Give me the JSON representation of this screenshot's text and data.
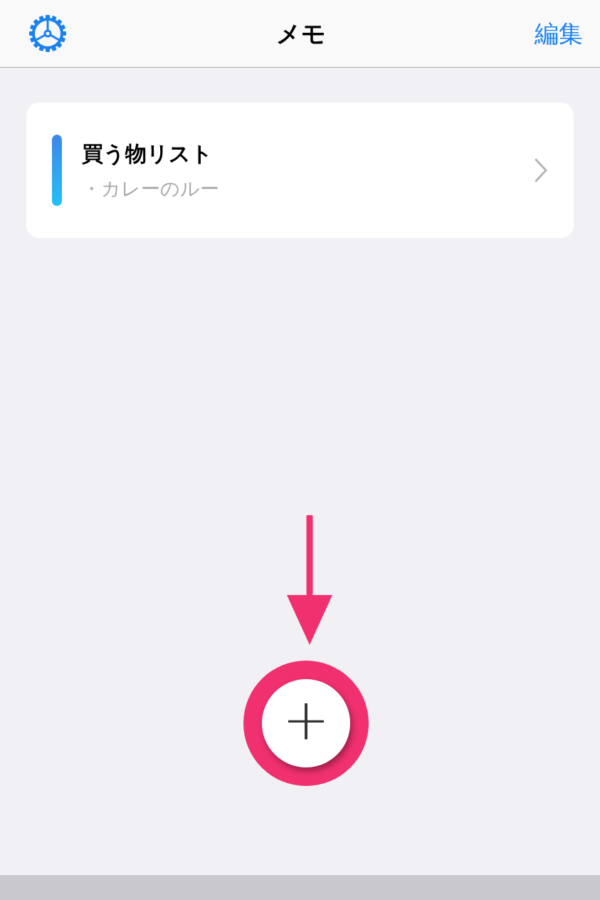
{
  "header": {
    "title": "メモ",
    "edit_button": "編集"
  },
  "notes": [
    {
      "title": "買う物リスト",
      "preview": "・カレーのルー"
    }
  ],
  "add_button": {
    "label": "+"
  }
}
